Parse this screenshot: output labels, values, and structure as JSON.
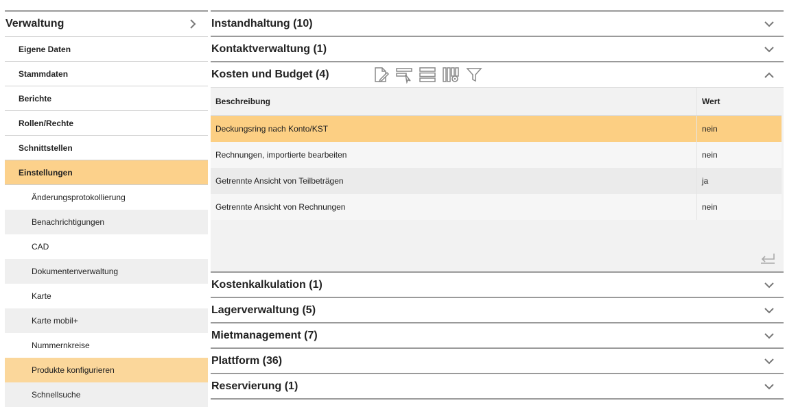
{
  "sidebar": {
    "title": "Verwaltung",
    "items": [
      {
        "label": "Eigene Daten"
      },
      {
        "label": "Stammdaten"
      },
      {
        "label": "Berichte"
      },
      {
        "label": "Rollen/Rechte"
      },
      {
        "label": "Schnittstellen"
      },
      {
        "label": "Einstellungen"
      }
    ],
    "subitems": [
      {
        "label": "Änderungsprotokollierung"
      },
      {
        "label": "Benachrichtigungen"
      },
      {
        "label": "CAD"
      },
      {
        "label": "Dokumentenverwaltung"
      },
      {
        "label": "Karte"
      },
      {
        "label": "Karte mobil+"
      },
      {
        "label": "Nummernkreise"
      },
      {
        "label": "Produkte konfigurieren"
      },
      {
        "label": "Schnellsuche"
      }
    ]
  },
  "sections_before": [
    {
      "title": "Instandhaltung (10)"
    },
    {
      "title": "Kontaktverwaltung (1)"
    }
  ],
  "open_section": {
    "title": "Kosten und Budget (4)",
    "table": {
      "headers": [
        "Beschreibung",
        "Wert"
      ],
      "rows": [
        {
          "desc": "Deckungsring nach Konto/KST",
          "value": "nein"
        },
        {
          "desc": "Rechnungen, importierte bearbeiten",
          "value": "nein"
        },
        {
          "desc": "Getrennte Ansicht von Teilbeträgen",
          "value": "ja"
        },
        {
          "desc": "Getrennte Ansicht von Rechnungen",
          "value": "nein"
        }
      ]
    }
  },
  "sections_after": [
    {
      "title": "Kostenkalkulation (1)"
    },
    {
      "title": "Lagerverwaltung (5)"
    },
    {
      "title": "Mietmanagement (7)"
    },
    {
      "title": "Plattform (36)"
    },
    {
      "title": "Reservierung (1)"
    }
  ],
  "colors": {
    "highlight": "#fcd18b",
    "selected_row": "#fccf83",
    "divider": "#9a9a9a"
  }
}
